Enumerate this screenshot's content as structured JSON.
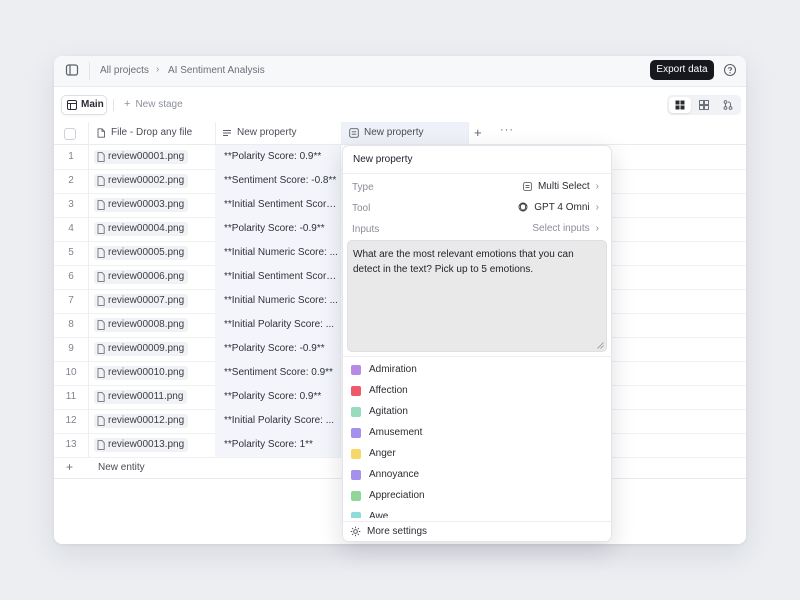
{
  "topbar": {
    "breadcrumb": [
      "All projects",
      "AI Sentiment Analysis"
    ],
    "breadcrumb_separator": "›",
    "export_label": "Export data"
  },
  "stagebar": {
    "main_tab": "Main",
    "new_stage": "New stage"
  },
  "table": {
    "headers": {
      "file": "File - Drop any file",
      "prop1": "New property",
      "prop2": "New property"
    },
    "rows": [
      {
        "idx": "1",
        "file": "review00001.png",
        "value": "**Polarity Score: 0.9**"
      },
      {
        "idx": "2",
        "file": "review00002.png",
        "value": "**Sentiment Score: -0.8**"
      },
      {
        "idx": "3",
        "file": "review00003.png",
        "value": "**Initial Sentiment Score..."
      },
      {
        "idx": "4",
        "file": "review00004.png",
        "value": "**Polarity Score: -0.9**"
      },
      {
        "idx": "5",
        "file": "review00005.png",
        "value": "**Initial Numeric Score: ..."
      },
      {
        "idx": "6",
        "file": "review00006.png",
        "value": "**Initial Sentiment Score..."
      },
      {
        "idx": "7",
        "file": "review00007.png",
        "value": "**Initial Numeric Score: ..."
      },
      {
        "idx": "8",
        "file": "review00008.png",
        "value": "**Initial Polarity Score: ..."
      },
      {
        "idx": "9",
        "file": "review00009.png",
        "value": "**Polarity Score: -0.9**"
      },
      {
        "idx": "10",
        "file": "review00010.png",
        "value": "**Sentiment Score: 0.9**"
      },
      {
        "idx": "11",
        "file": "review00011.png",
        "value": "**Polarity Score: 0.9**"
      },
      {
        "idx": "12",
        "file": "review00012.png",
        "value": "**Initial Polarity Score: ..."
      },
      {
        "idx": "13",
        "file": "review00013.png",
        "value": "**Polarity Score: 1**"
      }
    ],
    "new_entity": "New entity"
  },
  "popover": {
    "title": "New property",
    "type_label": "Type",
    "type_value": "Multi Select",
    "tool_label": "Tool",
    "tool_value": "GPT 4 Omni",
    "inputs_label": "Inputs",
    "inputs_value": "Select inputs",
    "prompt": "What are the most relevant emotions that you can detect in the text? Pick up to 5 emotions.",
    "options": [
      {
        "label": "Admiration",
        "color": "#b78ae6"
      },
      {
        "label": "Affection",
        "color": "#ef5a6a"
      },
      {
        "label": "Agitation",
        "color": "#98dcc0"
      },
      {
        "label": "Amusement",
        "color": "#a590ec"
      },
      {
        "label": "Anger",
        "color": "#f6d86a"
      },
      {
        "label": "Annoyance",
        "color": "#a590ec"
      },
      {
        "label": "Appreciation",
        "color": "#8fd69a"
      },
      {
        "label": "Awe",
        "color": "#8fdcd6"
      }
    ],
    "more_settings": "More settings"
  }
}
